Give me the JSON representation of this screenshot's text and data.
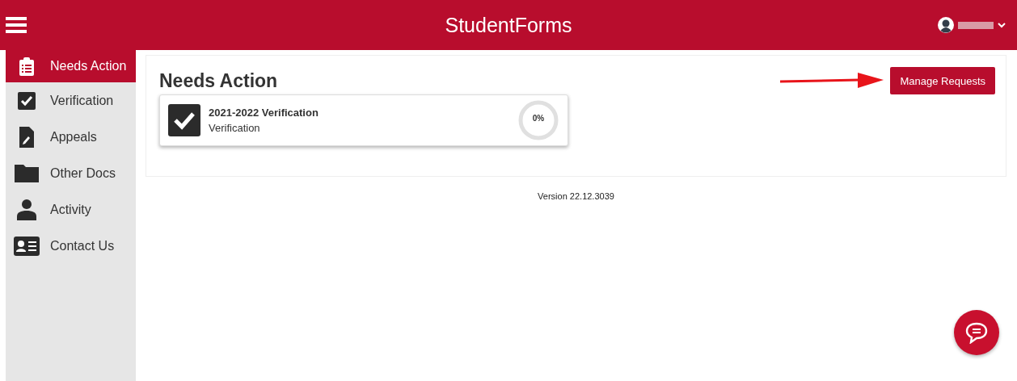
{
  "header": {
    "title": "StudentForms"
  },
  "sidebar": {
    "items": [
      {
        "label": "Needs Action",
        "selected": true
      },
      {
        "label": "Verification",
        "selected": false
      },
      {
        "label": "Appeals",
        "selected": false
      },
      {
        "label": "Other Docs",
        "selected": false
      },
      {
        "label": "Activity",
        "selected": false
      },
      {
        "label": "Contact Us",
        "selected": false
      }
    ]
  },
  "main": {
    "heading": "Needs Action",
    "action_button": "Manage Requests",
    "cards": [
      {
        "title": "2021-2022 Verification",
        "subtitle": "Verification",
        "progress": "0%",
        "level": 0
      }
    ]
  },
  "footer": {
    "version": "Version 22.12.3039"
  }
}
